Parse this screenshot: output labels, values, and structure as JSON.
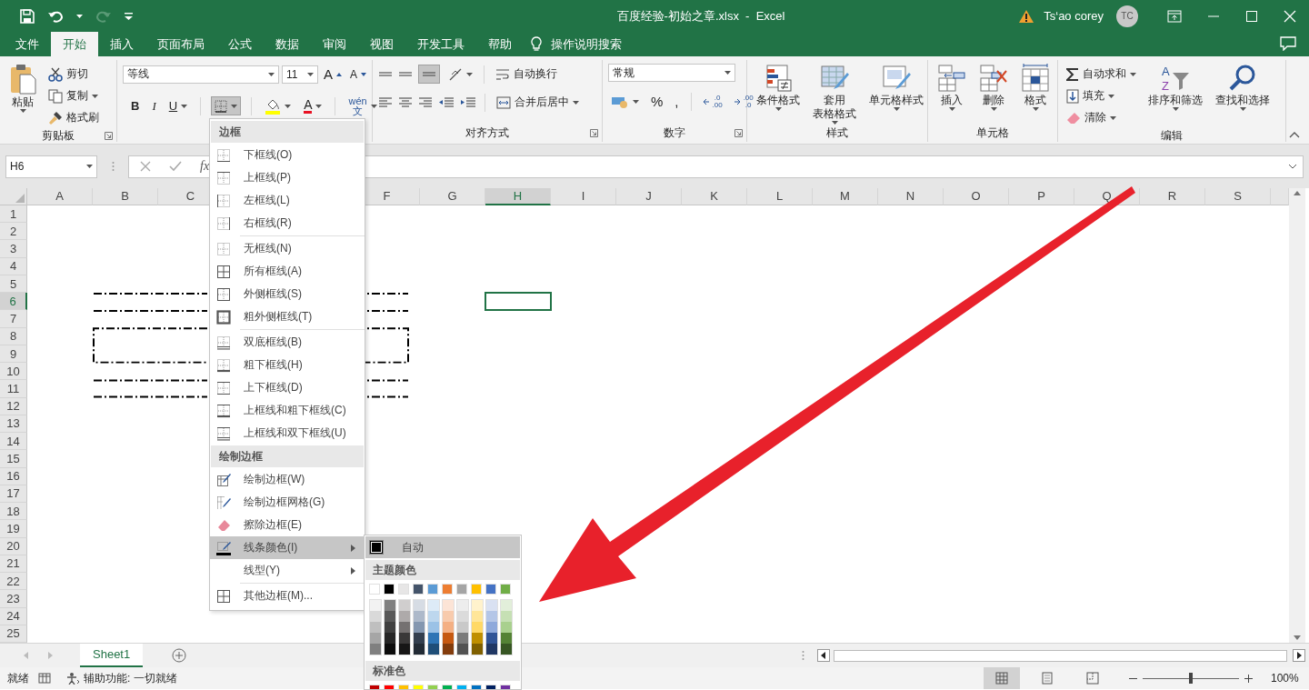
{
  "title_bar": {
    "title": "百度经验-初始之章.xlsx  -  Excel",
    "user": "Ts‘ao corey",
    "avatar": "TC"
  },
  "tabs": [
    {
      "label": "文件",
      "selected": false
    },
    {
      "label": "开始",
      "selected": true
    },
    {
      "label": "插入",
      "selected": false
    },
    {
      "label": "页面布局",
      "selected": false
    },
    {
      "label": "公式",
      "selected": false
    },
    {
      "label": "数据",
      "selected": false
    },
    {
      "label": "审阅",
      "selected": false
    },
    {
      "label": "视图",
      "selected": false
    },
    {
      "label": "开发工具",
      "selected": false
    },
    {
      "label": "帮助",
      "selected": false
    }
  ],
  "tell_me": "操作说明搜索",
  "ribbon": {
    "clipboard": {
      "label": "剪贴板",
      "paste": "粘贴",
      "cut": "剪切",
      "copy": "复制",
      "format_painter": "格式刷"
    },
    "font": {
      "font_name": "等线",
      "font_size": "11",
      "grow": "A",
      "shrink": "A",
      "bold": "B",
      "italic": "I",
      "underline": "U",
      "border_button_pressed": true,
      "font_color": "A",
      "phonetic_top": "wén",
      "phonetic_bottom": "文"
    },
    "alignment": {
      "label": "对齐方式",
      "wrap_text": "自动换行",
      "merge_center": "合并后居中",
      "bottom_align_pressed": true
    },
    "number": {
      "label": "数字",
      "format": "常规",
      "percent": "%",
      "comma": ",",
      "increase_decimal": [
        ".0",
        ".00"
      ],
      "decrease_decimal": [
        ".00",
        ".0"
      ]
    },
    "styles": {
      "label": "样式",
      "conditional": "条件格式",
      "table_format": [
        "套用",
        "表格格式"
      ],
      "cell_styles": "单元格样式"
    },
    "cells": {
      "label": "单元格",
      "insert": "插入",
      "delete": "删除",
      "format": "格式"
    },
    "editing": {
      "label": "编辑",
      "autosum": "自动求和",
      "fill": "填充",
      "clear": "清除",
      "sort_glyph": [
        "A",
        "Z"
      ],
      "sort_filter": "排序和筛选",
      "find_select": "查找和选择"
    }
  },
  "formula_bar": {
    "name_box": "H6",
    "function_glyph": "fx"
  },
  "sheet": {
    "columns": [
      {
        "kind": "header",
        "label": "A",
        "selected": false
      },
      {
        "kind": "header",
        "label": "B",
        "selected": false
      },
      {
        "kind": "header",
        "label": "C",
        "selected": false
      },
      {
        "kind": "covered"
      },
      {
        "kind": "covered"
      },
      {
        "kind": "header",
        "label": "F",
        "selected": false
      },
      {
        "kind": "header",
        "label": "G",
        "selected": false
      },
      {
        "kind": "header",
        "label": "H",
        "selected": true
      },
      {
        "kind": "header",
        "label": "I",
        "selected": false
      },
      {
        "kind": "header",
        "label": "J",
        "selected": false
      },
      {
        "kind": "header",
        "label": "K",
        "selected": false
      },
      {
        "kind": "header",
        "label": "L",
        "selected": false
      },
      {
        "kind": "header",
        "label": "M",
        "selected": false
      },
      {
        "kind": "header",
        "label": "N",
        "selected": false
      },
      {
        "kind": "header",
        "label": "O",
        "selected": false
      },
      {
        "kind": "header",
        "label": "P",
        "selected": false
      },
      {
        "kind": "header",
        "label": "Q",
        "selected": false
      },
      {
        "kind": "header",
        "label": "R",
        "selected": false
      },
      {
        "kind": "header",
        "label": "S",
        "selected": false
      }
    ],
    "rows": [
      {
        "label": "1",
        "selected": false
      },
      {
        "label": "2",
        "selected": false
      },
      {
        "label": "3",
        "selected": false
      },
      {
        "label": "4",
        "selected": false
      },
      {
        "label": "5",
        "selected": false
      },
      {
        "label": "6",
        "selected": true
      },
      {
        "label": "7",
        "selected": false
      },
      {
        "label": "8",
        "selected": false
      },
      {
        "label": "9",
        "selected": false
      },
      {
        "label": "10",
        "selected": false
      },
      {
        "label": "11",
        "selected": false
      },
      {
        "label": "12",
        "selected": false
      },
      {
        "label": "13",
        "selected": false
      },
      {
        "label": "14",
        "selected": false
      },
      {
        "label": "15",
        "selected": false
      },
      {
        "label": "16",
        "selected": false
      },
      {
        "label": "17",
        "selected": false
      },
      {
        "label": "18",
        "selected": false
      },
      {
        "label": "19",
        "selected": false
      },
      {
        "label": "20",
        "selected": false
      },
      {
        "label": "21",
        "selected": false
      },
      {
        "label": "22",
        "selected": false
      },
      {
        "label": "23",
        "selected": false
      },
      {
        "label": "24",
        "selected": false
      },
      {
        "label": "25",
        "selected": false
      }
    ]
  },
  "border_menu": {
    "sections": [
      {
        "title": "边框",
        "items": [
          {
            "kind": "item",
            "label": "下框线(O)",
            "selected": false,
            "has_submenu": false
          },
          {
            "kind": "item",
            "label": "上框线(P)",
            "selected": false,
            "has_submenu": false
          },
          {
            "kind": "item",
            "label": "左框线(L)",
            "selected": false,
            "has_submenu": false
          },
          {
            "kind": "item",
            "label": "右框线(R)",
            "selected": false,
            "has_submenu": false
          },
          {
            "kind": "separator"
          },
          {
            "kind": "item",
            "label": "无框线(N)",
            "selected": false,
            "has_submenu": false
          },
          {
            "kind": "item",
            "label": "所有框线(A)",
            "selected": false,
            "has_submenu": false
          },
          {
            "kind": "item",
            "label": "外侧框线(S)",
            "selected": false,
            "has_submenu": false
          },
          {
            "kind": "item",
            "label": "粗外侧框线(T)",
            "selected": false,
            "has_submenu": false
          },
          {
            "kind": "separator"
          },
          {
            "kind": "item",
            "label": "双底框线(B)",
            "selected": false,
            "has_submenu": false
          },
          {
            "kind": "item",
            "label": "粗下框线(H)",
            "selected": false,
            "has_submenu": false
          },
          {
            "kind": "item",
            "label": "上下框线(D)",
            "selected": false,
            "has_submenu": false
          },
          {
            "kind": "item",
            "label": "上框线和粗下框线(C)",
            "selected": false,
            "has_submenu": false
          },
          {
            "kind": "item",
            "label": "上框线和双下框线(U)",
            "selected": false,
            "has_submenu": false
          }
        ]
      },
      {
        "title": "绘制边框",
        "items": [
          {
            "kind": "item",
            "label": "绘制边框(W)",
            "selected": false,
            "has_submenu": false
          },
          {
            "kind": "item",
            "label": "绘制边框网格(G)",
            "selected": false,
            "has_submenu": false
          },
          {
            "kind": "item",
            "label": "擦除边框(E)",
            "selected": false,
            "has_submenu": false
          },
          {
            "kind": "item",
            "label": "线条颜色(I)",
            "selected": true,
            "has_submenu": true
          },
          {
            "kind": "item",
            "label": "线型(Y)",
            "selected": false,
            "has_submenu": true
          },
          {
            "kind": "separator"
          },
          {
            "kind": "item",
            "label": "其他边框(M)...",
            "selected": false,
            "has_submenu": false
          }
        ]
      }
    ]
  },
  "color_menu": {
    "automatic": {
      "label": "自动",
      "color": "#000000",
      "selected": true
    },
    "theme_title": "主题颜色",
    "theme_colors": [
      {
        "color": "#ffffff",
        "shades": [
          {
            "color": "#f2f2f2"
          },
          {
            "color": "#d9d9d9"
          },
          {
            "color": "#bfbfbf"
          },
          {
            "color": "#a6a6a6"
          },
          {
            "color": "#808080"
          }
        ]
      },
      {
        "color": "#000000",
        "shades": [
          {
            "color": "#808080"
          },
          {
            "color": "#595959"
          },
          {
            "color": "#404040"
          },
          {
            "color": "#262626"
          },
          {
            "color": "#0d0d0d"
          }
        ]
      },
      {
        "color": "#e7e6e6",
        "shades": [
          {
            "color": "#d0cece"
          },
          {
            "color": "#aeaaaa"
          },
          {
            "color": "#757171"
          },
          {
            "color": "#3a3838"
          },
          {
            "color": "#171616"
          }
        ]
      },
      {
        "color": "#44546a",
        "shades": [
          {
            "color": "#d6dce4"
          },
          {
            "color": "#adb9ca"
          },
          {
            "color": "#8497b0"
          },
          {
            "color": "#333f4f"
          },
          {
            "color": "#222b35"
          }
        ]
      },
      {
        "color": "#5b9bd5",
        "shades": [
          {
            "color": "#ddebf7"
          },
          {
            "color": "#bdd7ee"
          },
          {
            "color": "#9bc2e6"
          },
          {
            "color": "#2f75b5"
          },
          {
            "color": "#1f4e78"
          }
        ]
      },
      {
        "color": "#ed7d31",
        "shades": [
          {
            "color": "#fce4d6"
          },
          {
            "color": "#f8cbad"
          },
          {
            "color": "#f4b084"
          },
          {
            "color": "#c65911"
          },
          {
            "color": "#833c0c"
          }
        ]
      },
      {
        "color": "#a5a5a5",
        "shades": [
          {
            "color": "#ededed"
          },
          {
            "color": "#dbdbdb"
          },
          {
            "color": "#c9c9c9"
          },
          {
            "color": "#7b7b7b"
          },
          {
            "color": "#525252"
          }
        ]
      },
      {
        "color": "#ffc000",
        "shades": [
          {
            "color": "#fff2cc"
          },
          {
            "color": "#ffe699"
          },
          {
            "color": "#ffd966"
          },
          {
            "color": "#bf8f00"
          },
          {
            "color": "#806000"
          }
        ]
      },
      {
        "color": "#4472c4",
        "shades": [
          {
            "color": "#d9e1f2"
          },
          {
            "color": "#b4c6e7"
          },
          {
            "color": "#8ea9db"
          },
          {
            "color": "#305496"
          },
          {
            "color": "#203764"
          }
        ]
      },
      {
        "color": "#70ad47",
        "shades": [
          {
            "color": "#e2efda"
          },
          {
            "color": "#c6e0b4"
          },
          {
            "color": "#a9d08e"
          },
          {
            "color": "#548235"
          },
          {
            "color": "#375623"
          }
        ]
      }
    ],
    "standard_title": "标准色",
    "standard_colors": [
      {
        "color": "#c00000"
      },
      {
        "color": "#ff0000"
      },
      {
        "color": "#ffc000"
      },
      {
        "color": "#ffff00"
      },
      {
        "color": "#92d050"
      },
      {
        "color": "#00b050"
      },
      {
        "color": "#00b0f0"
      },
      {
        "color": "#0070c0"
      },
      {
        "color": "#002060"
      },
      {
        "color": "#7030a0"
      }
    ]
  },
  "sheet_tabs": [
    {
      "label": "Sheet1",
      "selected": true
    }
  ],
  "status_bar": {
    "status": "就绪",
    "accessibility": "辅助功能: 一切就绪",
    "views": [
      {
        "selected": true
      },
      {
        "selected": false
      },
      {
        "selected": false
      }
    ],
    "zoom": {
      "level": 0.5,
      "reading": "100%"
    }
  }
}
